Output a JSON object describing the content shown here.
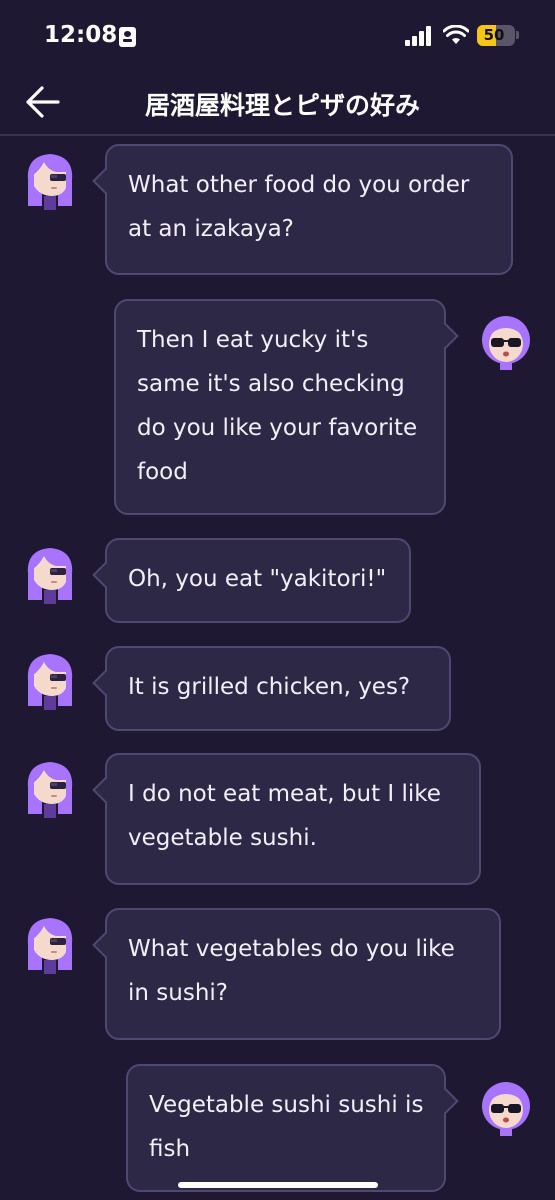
{
  "status_bar": {
    "time": "12:08",
    "battery_level": "50",
    "battery_color": "#f5c518"
  },
  "header": {
    "back_icon": "arrow-left-icon",
    "title": "居酒屋料理とピザの好み"
  },
  "messages": [
    {
      "sender": "bot",
      "avatar": "lily-avatar",
      "text": "What other food do you order at an izakaya?"
    },
    {
      "sender": "user",
      "avatar": "user-avatar",
      "text": "Then I eat yucky it's same it's also checking do you like your favorite food"
    },
    {
      "sender": "bot",
      "avatar": "lily-avatar",
      "text": "Oh, you eat \"yakitori!\""
    },
    {
      "sender": "bot",
      "avatar": "lily-avatar",
      "text": "It is grilled chicken, yes?"
    },
    {
      "sender": "bot",
      "avatar": "lily-avatar",
      "text": "I do not eat meat, but I like vegetable sushi."
    },
    {
      "sender": "bot",
      "avatar": "lily-avatar",
      "text": "What vegetables do you like in sushi?"
    },
    {
      "sender": "user",
      "avatar": "user-avatar",
      "text": "Vegetable sushi sushi is fish"
    }
  ],
  "colors": {
    "background": "#1f1833",
    "bubble": "#2e2847",
    "bubble_border": "#4f4870",
    "avatar_purple": "#a874ff"
  }
}
